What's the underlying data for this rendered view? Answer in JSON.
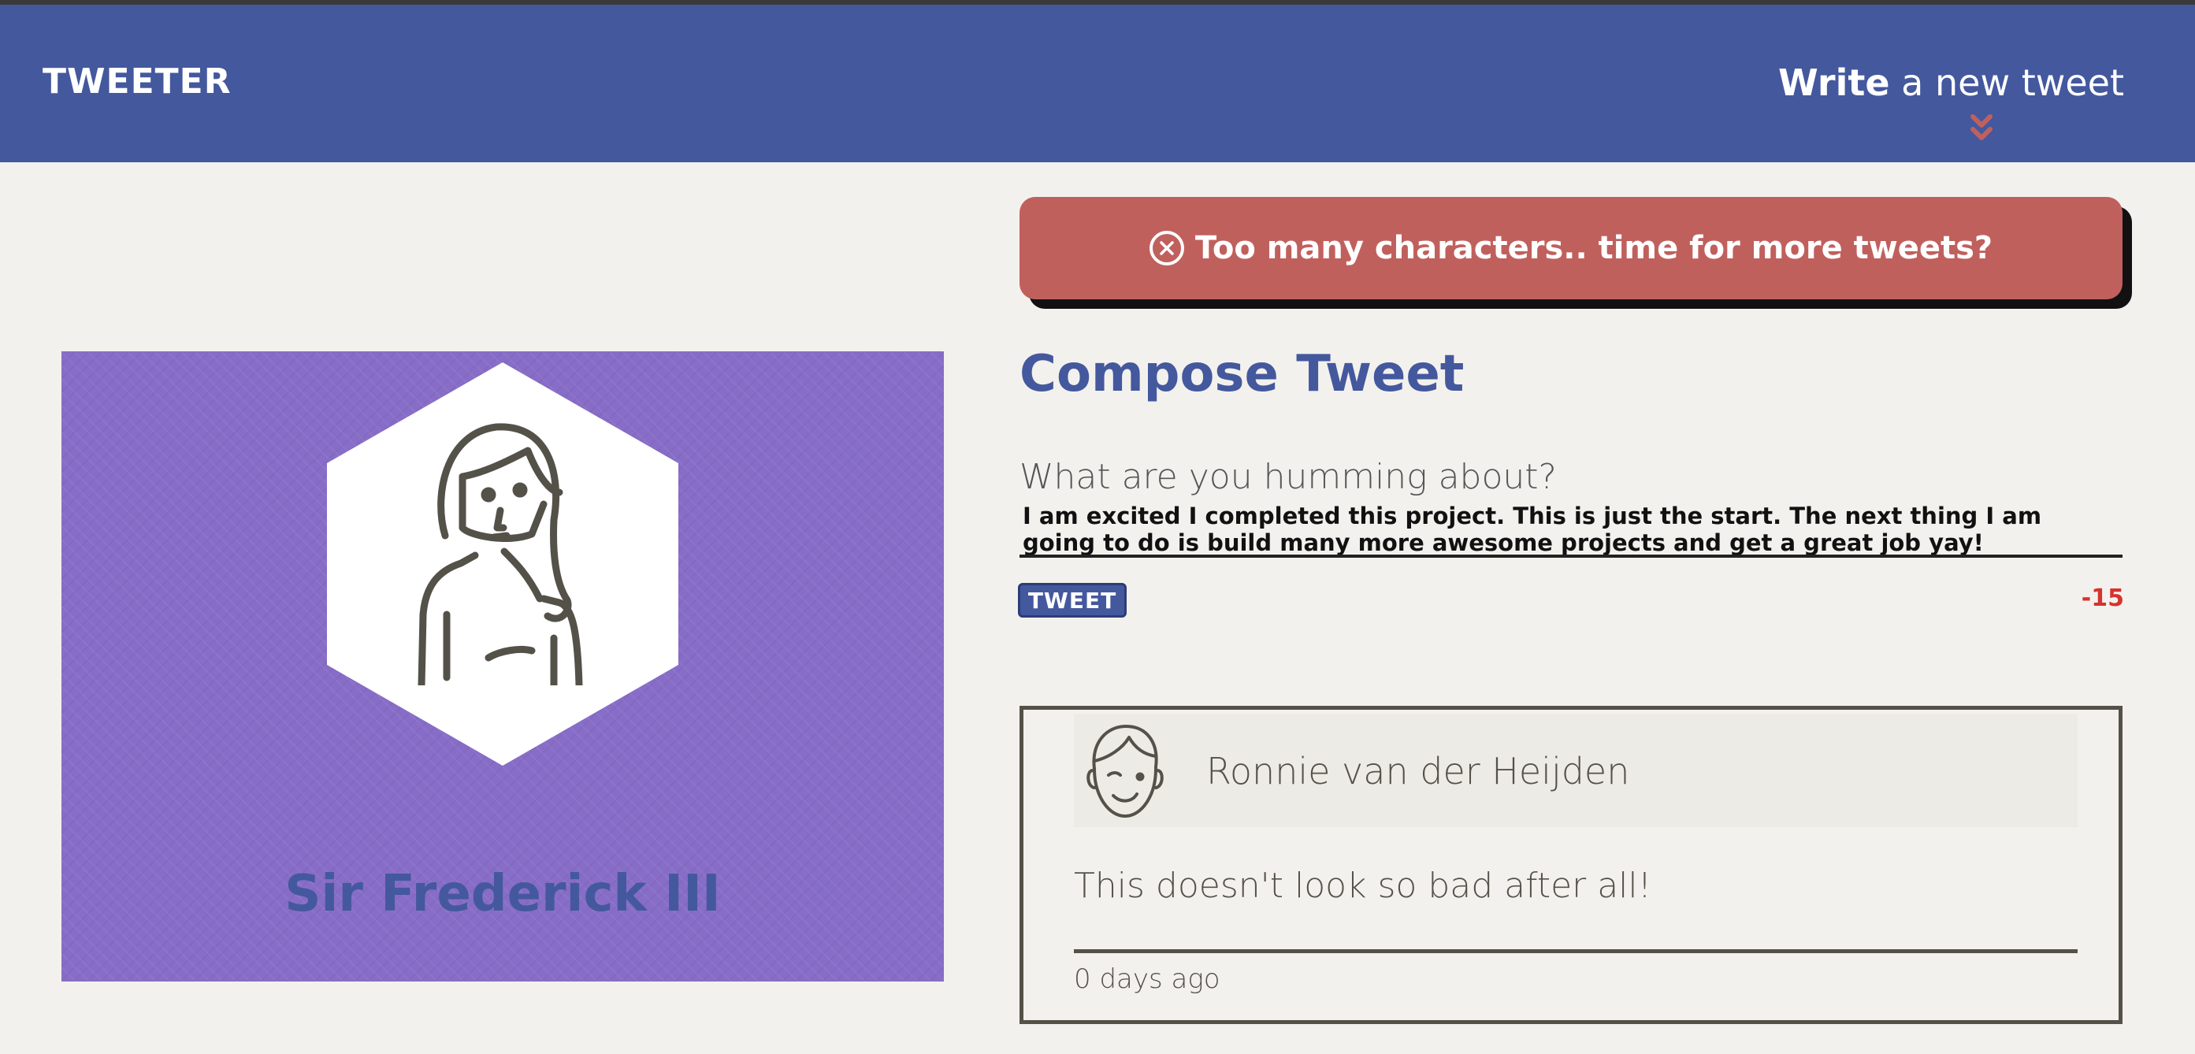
{
  "nav": {
    "brand": "TWEETER",
    "write_strong": "Write",
    "write_rest": " a new tweet",
    "chevron_icon": "double-chevron-down"
  },
  "profile": {
    "name": "Sir Frederick III",
    "avatar_icon": "person-long-hair"
  },
  "error": {
    "icon": "x-circle-icon",
    "message": "Too many characters.. time for more tweets?"
  },
  "compose": {
    "title": "Compose Tweet",
    "label": "What are you humming about?",
    "text": "I am excited I completed this project. This is just the start. The next thing I am going to do is build many more awesome projects and get a great job yay!",
    "button_label": "TWEET",
    "counter": "-15"
  },
  "tweets": [
    {
      "author": "Ronnie van der Heijden",
      "content": "This doesn't look so bad after all!",
      "time": "0 days ago",
      "avatar_icon": "smiling-face-outline"
    }
  ],
  "colors": {
    "nav_bg": "#44589e",
    "page_bg": "#f3f1ed",
    "profile_bg": "#876dc7",
    "error_bg": "#c0605d",
    "counter_red": "#d8322e",
    "card_border": "#545149"
  }
}
